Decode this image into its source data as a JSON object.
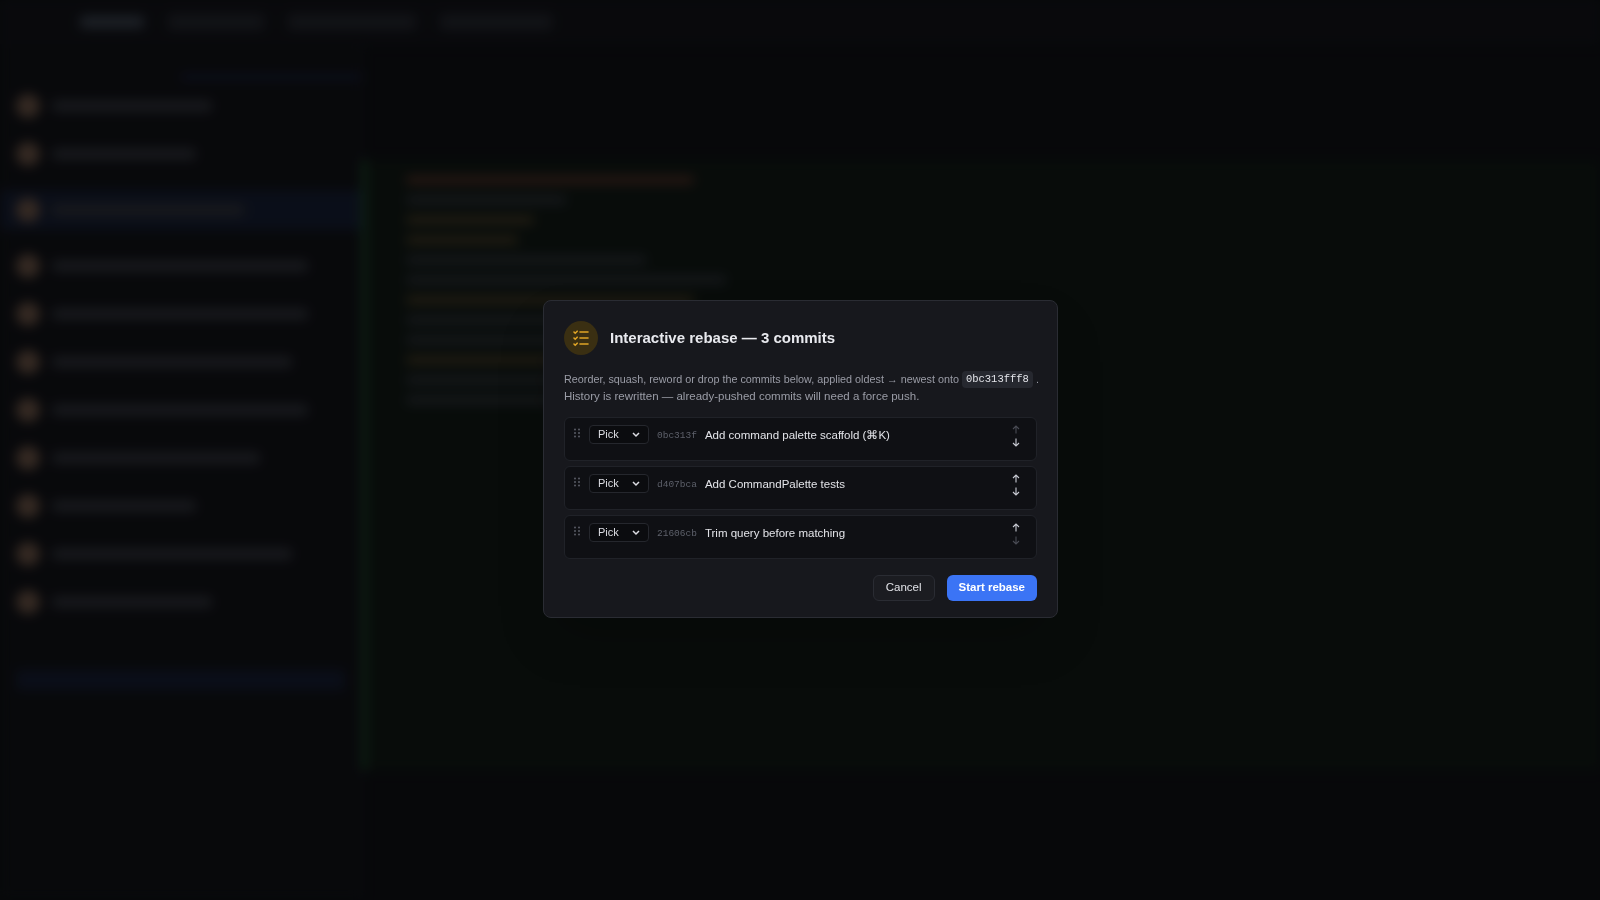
{
  "dialog": {
    "title": "Interactive rebase — 3 commits",
    "description": {
      "before": "Reorder, squash, reword or drop the commits below, applied oldest → newest onto",
      "base_hash": "0bc313fff8",
      "after": ".",
      "second_line": "History is rewritten — already-pushed commits will need a force push."
    },
    "commits": [
      {
        "action": "Pick",
        "hash": "0bc313f",
        "message": "Add command palette scaffold (⌘K)",
        "up_disabled": true,
        "down_disabled": false
      },
      {
        "action": "Pick",
        "hash": "d407bca",
        "message": "Add CommandPalette tests",
        "up_disabled": false,
        "down_disabled": false
      },
      {
        "action": "Pick",
        "hash": "21606cb",
        "message": "Trim query before matching",
        "up_disabled": false,
        "down_disabled": true
      }
    ],
    "buttons": [
      {
        "label": "Cancel",
        "kind": "secondary"
      },
      {
        "label": "Start rebase",
        "kind": "primary"
      }
    ]
  }
}
